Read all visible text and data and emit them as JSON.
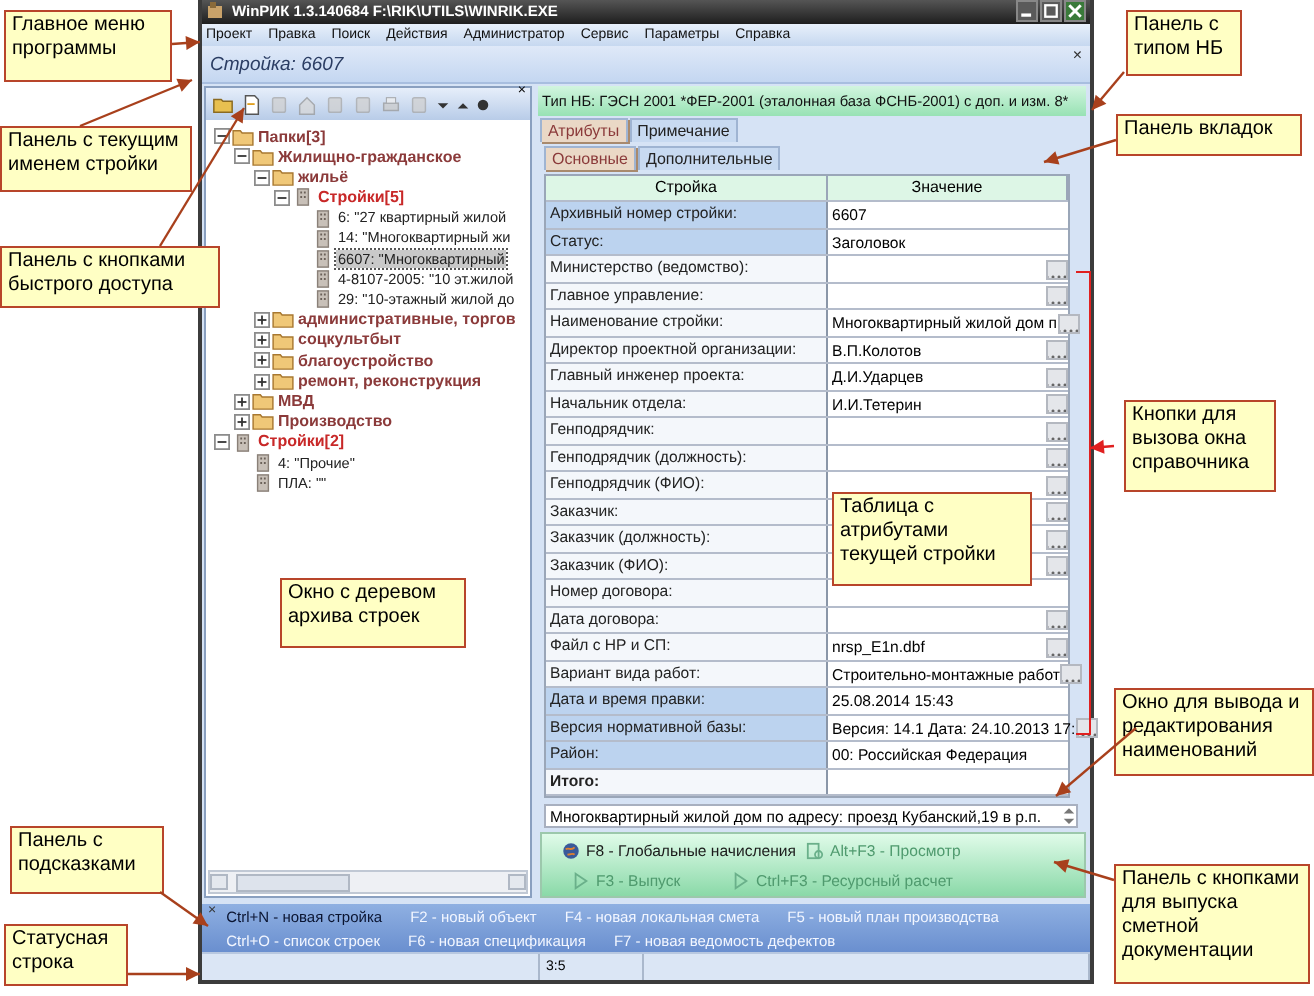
{
  "window": {
    "title": "WinРИК 1.3.140684  F:\\RIK\\UTILS\\WINRIK.EXE"
  },
  "menu": [
    "Проект",
    "Правка",
    "Поиск",
    "Действия",
    "Администратор",
    "Сервис",
    "Параметры",
    "Справка"
  ],
  "name_bar": {
    "title": "Стройка: 6607",
    "close": "×"
  },
  "toolbar": {
    "close": "×"
  },
  "tree": [
    {
      "label": "Папки[3]",
      "kind": "folder",
      "expanded": true,
      "children": [
        {
          "label": "Жилищно-гражданское",
          "kind": "folder",
          "expanded": true,
          "children": [
            {
              "label": "жильё",
              "kind": "folder",
              "expanded": true,
              "children": [
                {
                  "label": "Стройки[5]",
                  "kind": "group",
                  "expanded": true,
                  "children": [
                    {
                      "label": "6: \"27 квартирный жилой",
                      "kind": "estimate",
                      "selected": false
                    },
                    {
                      "label": "14: \"Многоквартирный жи",
                      "kind": "estimate",
                      "selected": false
                    },
                    {
                      "label": "6607: \"Многоквартирный",
                      "kind": "estimate",
                      "selected": true
                    },
                    {
                      "label": "4-8107-2005: \"10 эт.жилой",
                      "kind": "estimate",
                      "selected": false
                    },
                    {
                      "label": "29: \"10-этажный жилой до",
                      "kind": "estimate",
                      "selected": false
                    }
                  ]
                }
              ]
            },
            {
              "label": "административные, торгов",
              "kind": "folder",
              "expanded": false
            },
            {
              "label": "соцкультбыт",
              "kind": "folder",
              "expanded": false
            },
            {
              "label": "благоустройство",
              "kind": "folder",
              "expanded": false
            },
            {
              "label": "ремонт, реконструкция",
              "kind": "folder",
              "expanded": false
            }
          ]
        },
        {
          "label": "МВД",
          "kind": "folder",
          "expanded": false
        },
        {
          "label": "Производство",
          "kind": "folder",
          "expanded": false
        }
      ]
    },
    {
      "label": "Стройки[2]",
      "kind": "group",
      "expanded": true,
      "children": [
        {
          "label": "4: \"Прочие\"",
          "kind": "estimate",
          "selected": false
        },
        {
          "label": "ПЛА: \"\"",
          "kind": "estimate",
          "selected": false
        }
      ]
    }
  ],
  "nb_bar": {
    "text": "Тип НБ: ГЭСН 2001 *ФЕР-2001 (эталонная база ФСНБ-2001) с доп. и изм. 8*"
  },
  "tabs": [
    {
      "label": "Атрибуты",
      "selected": true
    },
    {
      "label": "Примечание",
      "selected": false
    }
  ],
  "subtabs": [
    {
      "label": "Основные",
      "selected": true
    },
    {
      "label": "Дополнительные",
      "selected": false
    }
  ],
  "table": {
    "columns": [
      "Стройка",
      "Значение"
    ],
    "rows": [
      {
        "label": "Архивный номер стройки:",
        "value": "6607",
        "readonly": true,
        "lookup": false,
        "bold": false
      },
      {
        "label": "Статус:",
        "value": "Заголовок",
        "readonly": true,
        "lookup": false,
        "bold": false
      },
      {
        "label": "Министерство (ведомство):",
        "value": "",
        "readonly": false,
        "lookup": true,
        "bold": false
      },
      {
        "label": "Главное управление:",
        "value": "",
        "readonly": false,
        "lookup": true,
        "bold": false
      },
      {
        "label": "Наименование стройки:",
        "value": "Многоквартирный жилой дом п",
        "readonly": false,
        "lookup": true,
        "bold": false
      },
      {
        "label": "Директор проектной организации:",
        "value": "В.П.Колотов",
        "readonly": false,
        "lookup": true,
        "bold": false
      },
      {
        "label": "Главный инженер проекта:",
        "value": "Д.И.Ударцев",
        "readonly": false,
        "lookup": true,
        "bold": false
      },
      {
        "label": "Начальник отдела:",
        "value": "И.И.Тетерин",
        "readonly": false,
        "lookup": true,
        "bold": false
      },
      {
        "label": "Генподрядчик:",
        "value": "",
        "readonly": false,
        "lookup": true,
        "bold": false
      },
      {
        "label": "Генподрядчик (должность):",
        "value": "",
        "readonly": false,
        "lookup": true,
        "bold": false
      },
      {
        "label": "Генподрядчик (ФИО):",
        "value": "",
        "readonly": false,
        "lookup": true,
        "bold": false
      },
      {
        "label": "Заказчик:",
        "value": "",
        "readonly": false,
        "lookup": true,
        "bold": false
      },
      {
        "label": "Заказчик (должность):",
        "value": "",
        "readonly": false,
        "lookup": true,
        "bold": false
      },
      {
        "label": "Заказчик (ФИО):",
        "value": "",
        "readonly": false,
        "lookup": true,
        "bold": false
      },
      {
        "label": "Номер договора:",
        "value": "",
        "readonly": false,
        "lookup": false,
        "bold": false
      },
      {
        "label": "Дата договора:",
        "value": "",
        "readonly": false,
        "lookup": true,
        "bold": false
      },
      {
        "label": "Файл с НР и СП:",
        "value": "nrsp_E1n.dbf",
        "readonly": false,
        "lookup": true,
        "bold": false
      },
      {
        "label": "Вариант вида работ:",
        "value": "Строительно-монтажные работ",
        "readonly": false,
        "lookup": true,
        "bold": false
      },
      {
        "label": "Дата и время правки:",
        "value": "25.08.2014  15:43",
        "readonly": true,
        "lookup": false,
        "bold": false
      },
      {
        "label": "Версия нормативной базы:",
        "value": "Версия: 14.1  Дата: 24.10.2013 17:",
        "readonly": true,
        "lookup": true,
        "bold": false
      },
      {
        "label": "Район:",
        "value": "00: Российская Федерация",
        "readonly": true,
        "lookup": false,
        "bold": false
      },
      {
        "label": "Итого:",
        "value": "",
        "readonly": false,
        "lookup": false,
        "bold": true
      }
    ]
  },
  "name_field": {
    "value": "Многоквартирный жилой дом по адресу: проезд Кубанский,19 в р.п."
  },
  "action_rows": [
    [
      {
        "label": "F8 - Глобальные начисления",
        "disabled": false
      },
      {
        "label": "Alt+F3 - Просмотр",
        "disabled": true
      }
    ],
    [
      {
        "label": "F3 - Выпуск",
        "disabled": true
      },
      {
        "label": "Ctrl+F3 - Ресурсный расчет",
        "disabled": true
      }
    ]
  ],
  "hints": {
    "close": "×",
    "rows": [
      [
        {
          "label": "Ctrl+N - новая стройка",
          "disabled": false
        },
        {
          "label": "F2 - новый объект",
          "disabled": true
        },
        {
          "label": "F4 - новая локальная смета",
          "disabled": true
        },
        {
          "label": "F5 - новый план производства",
          "disabled": true
        }
      ],
      [
        {
          "label": "Ctrl+O - список строек",
          "disabled": true
        },
        {
          "label": "F6 - новая спецификация",
          "disabled": true
        },
        {
          "label": "F7 - новая ведомость дефектов",
          "disabled": true
        }
      ]
    ]
  },
  "status_bar": {
    "position": "3:5"
  },
  "callouts": [
    "Главное меню программы",
    "Панель с текущим именем стройки",
    "Панель с кнопками быстрого доступа",
    "Окно с деревом архива строек",
    "Панель с подсказками",
    "Статусная строка",
    "Панель с типом НБ",
    "Панель вкладок",
    "Кнопки для вызова окна справочника",
    "Таблица с атрибутами текущей стройки",
    "Окно для вывода и редактирования наименований",
    "Панель с кнопками для выпуска сметной документации"
  ]
}
